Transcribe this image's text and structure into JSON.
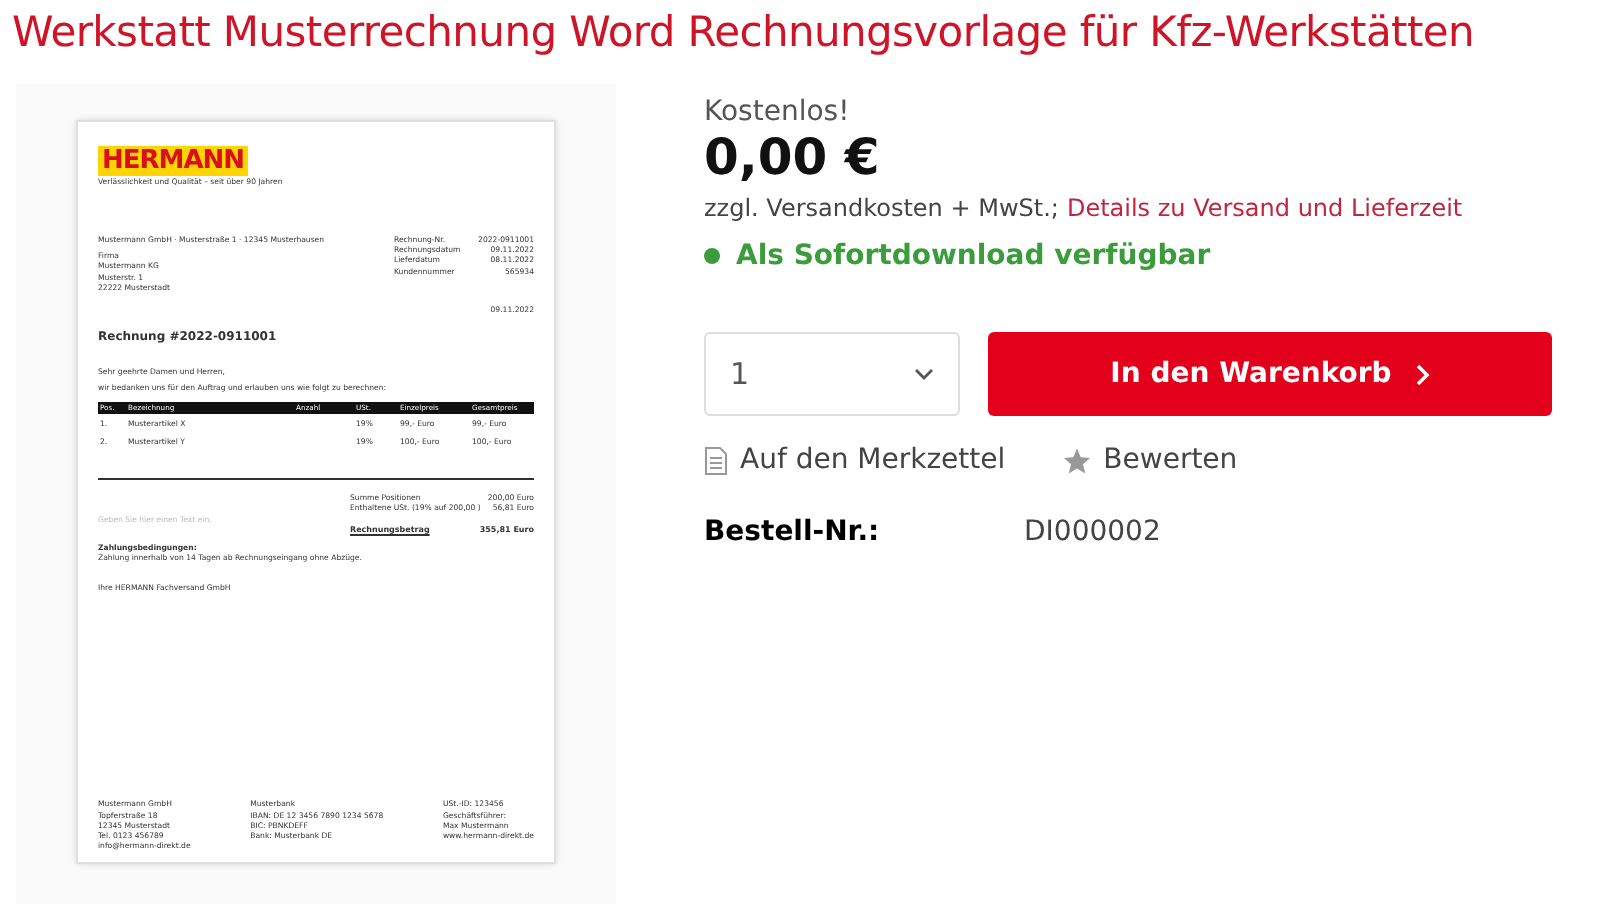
{
  "title": "Werkstatt Musterrechnung Word Rechnungsvorlage für Kfz-Werkstätten",
  "document": {
    "logo": "HERMANN",
    "tagline": "Verlässlichkeit und Qualität – seit über 90 Jahren",
    "sender_line": "Mustermann GmbH · Musterstraße 1 · 12345 Musterhausen",
    "address": [
      "Firma",
      "Mustermann KG",
      "Musterstr. 1",
      "22222 Musterstadt"
    ],
    "meta": [
      {
        "label": "Rechnung-Nr.",
        "value": "2022-0911001"
      },
      {
        "label": "Rechnungsdatum",
        "value": "09.11.2022"
      },
      {
        "label": "Lieferdatum",
        "value": "08.11.2022"
      },
      {
        "label": "Kundennummer",
        "value": "565934"
      }
    ],
    "date": "09.11.2022",
    "heading": "Rechnung #2022-0911001",
    "salutation": "Sehr geehrte Damen und Herren,",
    "intro": "wir bedanken uns für den Auftrag und erlauben uns wie folgt zu berechnen:",
    "columns": [
      "Pos.",
      "Bezeichnung",
      "Anzahl",
      "USt.",
      "Einzelpreis",
      "Gesamtpreis"
    ],
    "rows": [
      [
        "1.",
        "Musterartikel X",
        "",
        "19%",
        "99,- Euro",
        "99,- Euro"
      ],
      [
        "2.",
        "Musterartikel Y",
        "",
        "19%",
        "100,- Euro",
        "100,- Euro"
      ]
    ],
    "note_placeholder": "Geben Sie hier einen Text ein.",
    "totals": [
      {
        "label": "Summe Positionen",
        "value": "200,00 Euro",
        "bold": false
      },
      {
        "label": "Enthaltene USt. (19% auf 200,00 )",
        "value": "56,81 Euro",
        "bold": false
      },
      {
        "label": "Rechnungsbetrag",
        "value": "355,81 Euro",
        "bold": true
      }
    ],
    "terms_title": "Zahlungsbedingungen:",
    "terms": "Zahlung innerhalb von 14 Tagen ab Rechnungseingang ohne Abzüge.",
    "closing": "Ihre HERMANN Fachversand GmbH",
    "footer": [
      [
        "Mustermann GmbH",
        "Topferstraße 18",
        "12345 Musterstadt",
        "Tel. 0123 456789",
        "info@hermann-direkt.de"
      ],
      [
        "Musterbank",
        "IBAN: DE 12 3456 7890 1234 5678",
        "BIC: PBNKDEFF",
        "Bank: Musterbank DE"
      ],
      [
        "USt.-ID: 123456",
        "Geschäftsführer:",
        "Max Mustermann",
        "www.hermann-direkt.de"
      ]
    ]
  },
  "offer": {
    "badge": "Kostenlos!",
    "price": "0,00 €",
    "shipping_note": "zzgl. Versandkosten + MwSt.;",
    "shipping_link": "Details zu Versand und Lieferzeit",
    "availability": {
      "text": "Als Sofortdownload verfügbar",
      "color": "#3b9c3b"
    },
    "quantity": "1",
    "cart_button": "In den Warenkorb",
    "actions": [
      {
        "kind": "notepad",
        "label": "Auf den Merkzettel"
      },
      {
        "kind": "rate",
        "label": "Bewerten"
      }
    ],
    "order_number": {
      "label": "Bestell-Nr.:",
      "value": "DI000002"
    }
  }
}
